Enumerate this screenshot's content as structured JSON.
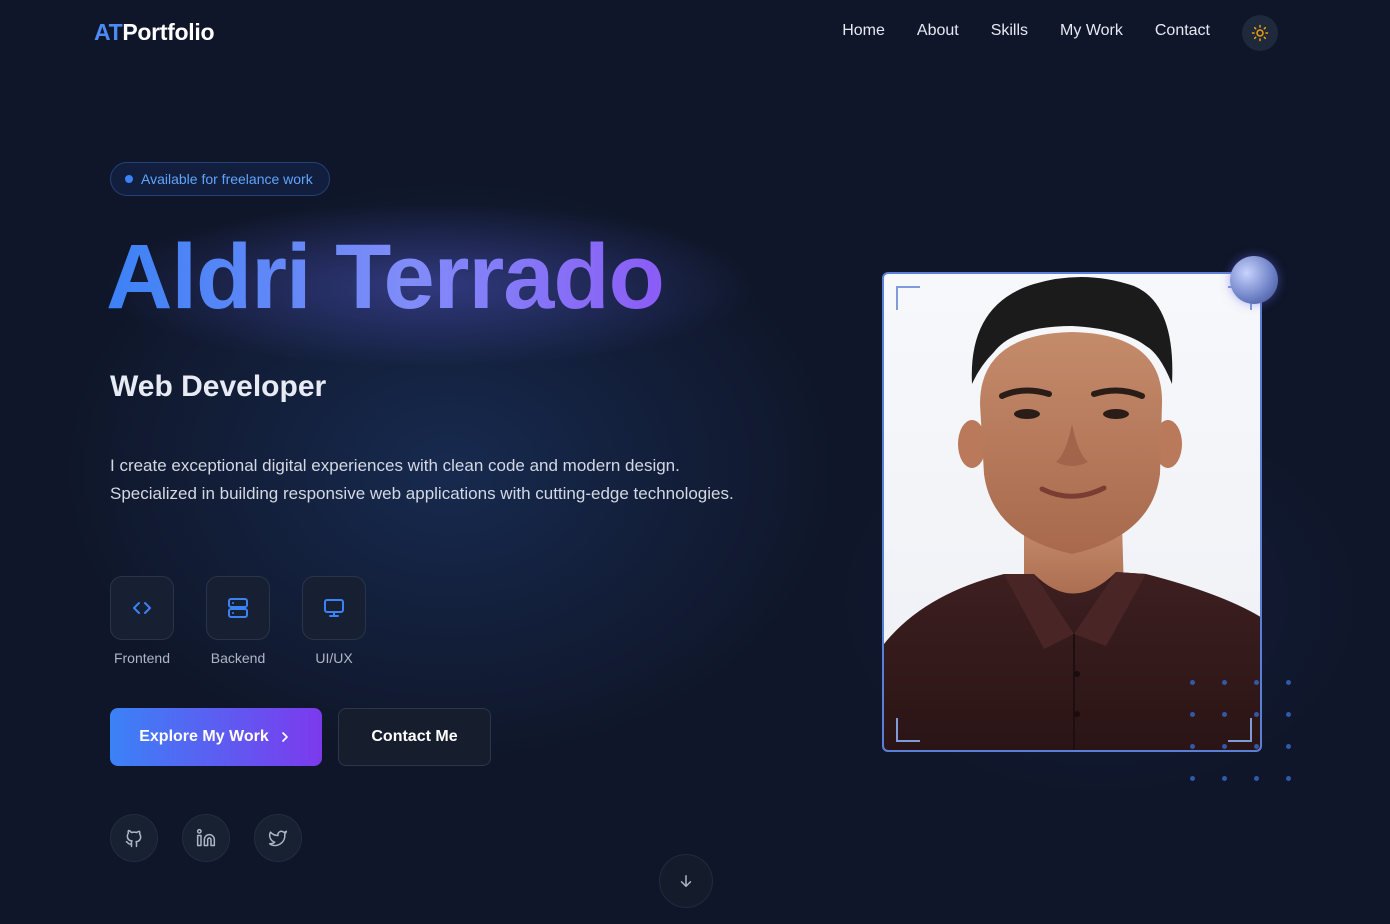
{
  "nav": {
    "logo_initials": "AT",
    "logo_text": "Portfolio",
    "links": [
      "Home",
      "About",
      "Skills",
      "My Work",
      "Contact"
    ],
    "theme_icon": "sun-icon"
  },
  "hero": {
    "badge": "Available for freelance work",
    "name": "Aldri Terrado",
    "role": "Web Developer",
    "description": "I create exceptional digital experiences with clean code and modern design. Specialized in building responsive web applications with cutting-edge technologies.",
    "skills": [
      {
        "label": "Frontend",
        "icon": "code-icon"
      },
      {
        "label": "Backend",
        "icon": "server-icon"
      },
      {
        "label": "UI/UX",
        "icon": "monitor-icon"
      }
    ],
    "primary_button": "Explore My Work",
    "secondary_button": "Contact Me",
    "socials": [
      "github-icon",
      "linkedin-icon",
      "twitter-icon"
    ],
    "scroll_icon": "arrow-down-icon"
  },
  "colors": {
    "background": "#0f1629",
    "accent_blue": "#3b82f6",
    "accent_purple": "#8b5cf6",
    "theme_sun": "#f59e0b"
  }
}
